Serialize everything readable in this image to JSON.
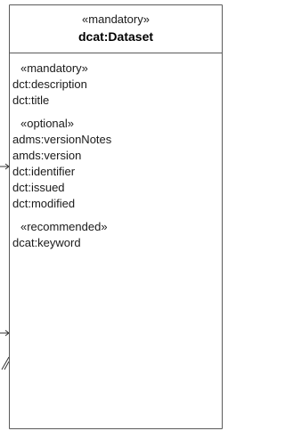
{
  "class_box": {
    "stereotype": "«mandatory»",
    "name": "dcat:Dataset",
    "sections": [
      {
        "title": "«mandatory»",
        "attributes": [
          "dct:description",
          "dct:title"
        ]
      },
      {
        "title": "«optional»",
        "attributes": [
          "adms:versionNotes",
          "amds:version",
          "dct:identifier",
          "dct:issued",
          "dct:modified"
        ]
      },
      {
        "title": "«recommended»",
        "attributes": [
          "dcat:keyword"
        ]
      }
    ]
  },
  "colors": {
    "border": "#5a5a5a",
    "text": "#1a1a1a",
    "connector": "#333333"
  }
}
